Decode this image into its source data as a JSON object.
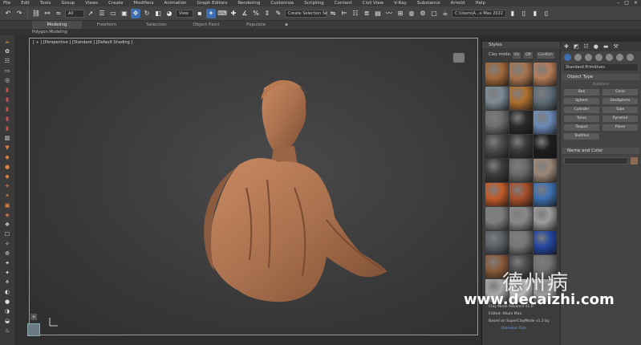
{
  "menu": {
    "items": [
      "File",
      "Edit",
      "Tools",
      "Group",
      "Views",
      "Create",
      "Modifiers",
      "Animation",
      "Graph Editors",
      "Rendering",
      "Customize",
      "Scripting",
      "Content",
      "Civil View",
      "V-Ray",
      "Substance",
      "Arnold",
      "Help"
    ]
  },
  "toolbar": {
    "selection_filter": "All",
    "view_dropdown": "View",
    "selection_set": "Create Selection Se",
    "workspace_path": "C:\\Users\\A...e Max 2022"
  },
  "ribbon": {
    "tabs": [
      "Modeling",
      "Freeform",
      "Selection",
      "Object Paint",
      "Populate"
    ],
    "sub_label": "Polygon Modeling"
  },
  "viewport": {
    "label": "[ + ] [Perspective ] [Standard ] [Default Shading ]"
  },
  "styles_panel": {
    "title": "Styles",
    "mode_label": "Clay mode:",
    "mode_buttons": [
      "On",
      "Off",
      "Confirm"
    ],
    "swatch_colors": [
      "#a0683a",
      "#a9744f",
      "#b57c57",
      "#7c8b96",
      "#b07030",
      "#5e6c78",
      "#6d6d6d",
      "#2a2a2a",
      "#6b8ab8",
      "#4a4a4a",
      "#3a3a3a",
      "#1e1e1e",
      "#3c3c3c",
      "#6a6a6a",
      "#9c8878",
      "#c25a2a",
      "#a74f2b",
      "#3f6fb0",
      "#7d7d7d",
      "#8a8a8a",
      "#9b9b9b",
      "#5a6066",
      "#777777",
      "#2446a0",
      "#8a5a3a",
      "#4c4c4c",
      "#707070",
      "#a8a8a8",
      "#bbbbbb",
      "#9a9a9a"
    ],
    "info_lines": [
      "Clay Mode Advance v1.0",
      "Edited: XKam Max",
      "Based on SuperClayMode v1.3 by"
    ],
    "info_author": "Dionseus Run"
  },
  "command_panel": {
    "category": "Standard Primitives",
    "object_type_title": "Object Type",
    "autogrid": "AutoGrid",
    "objects": [
      "Box",
      "Cone",
      "Sphere",
      "GeoSphere",
      "Cylinder",
      "Tube",
      "Torus",
      "Pyramid",
      "Teapot",
      "Plane",
      "TextPlus",
      ""
    ],
    "name_color_title": "Name and Color"
  },
  "watermark": {
    "chinese": "德州病",
    "url": "www.decaizhi.com"
  },
  "colors": {
    "accent": "#3d6fb0",
    "sculpture": "#a9714e"
  }
}
